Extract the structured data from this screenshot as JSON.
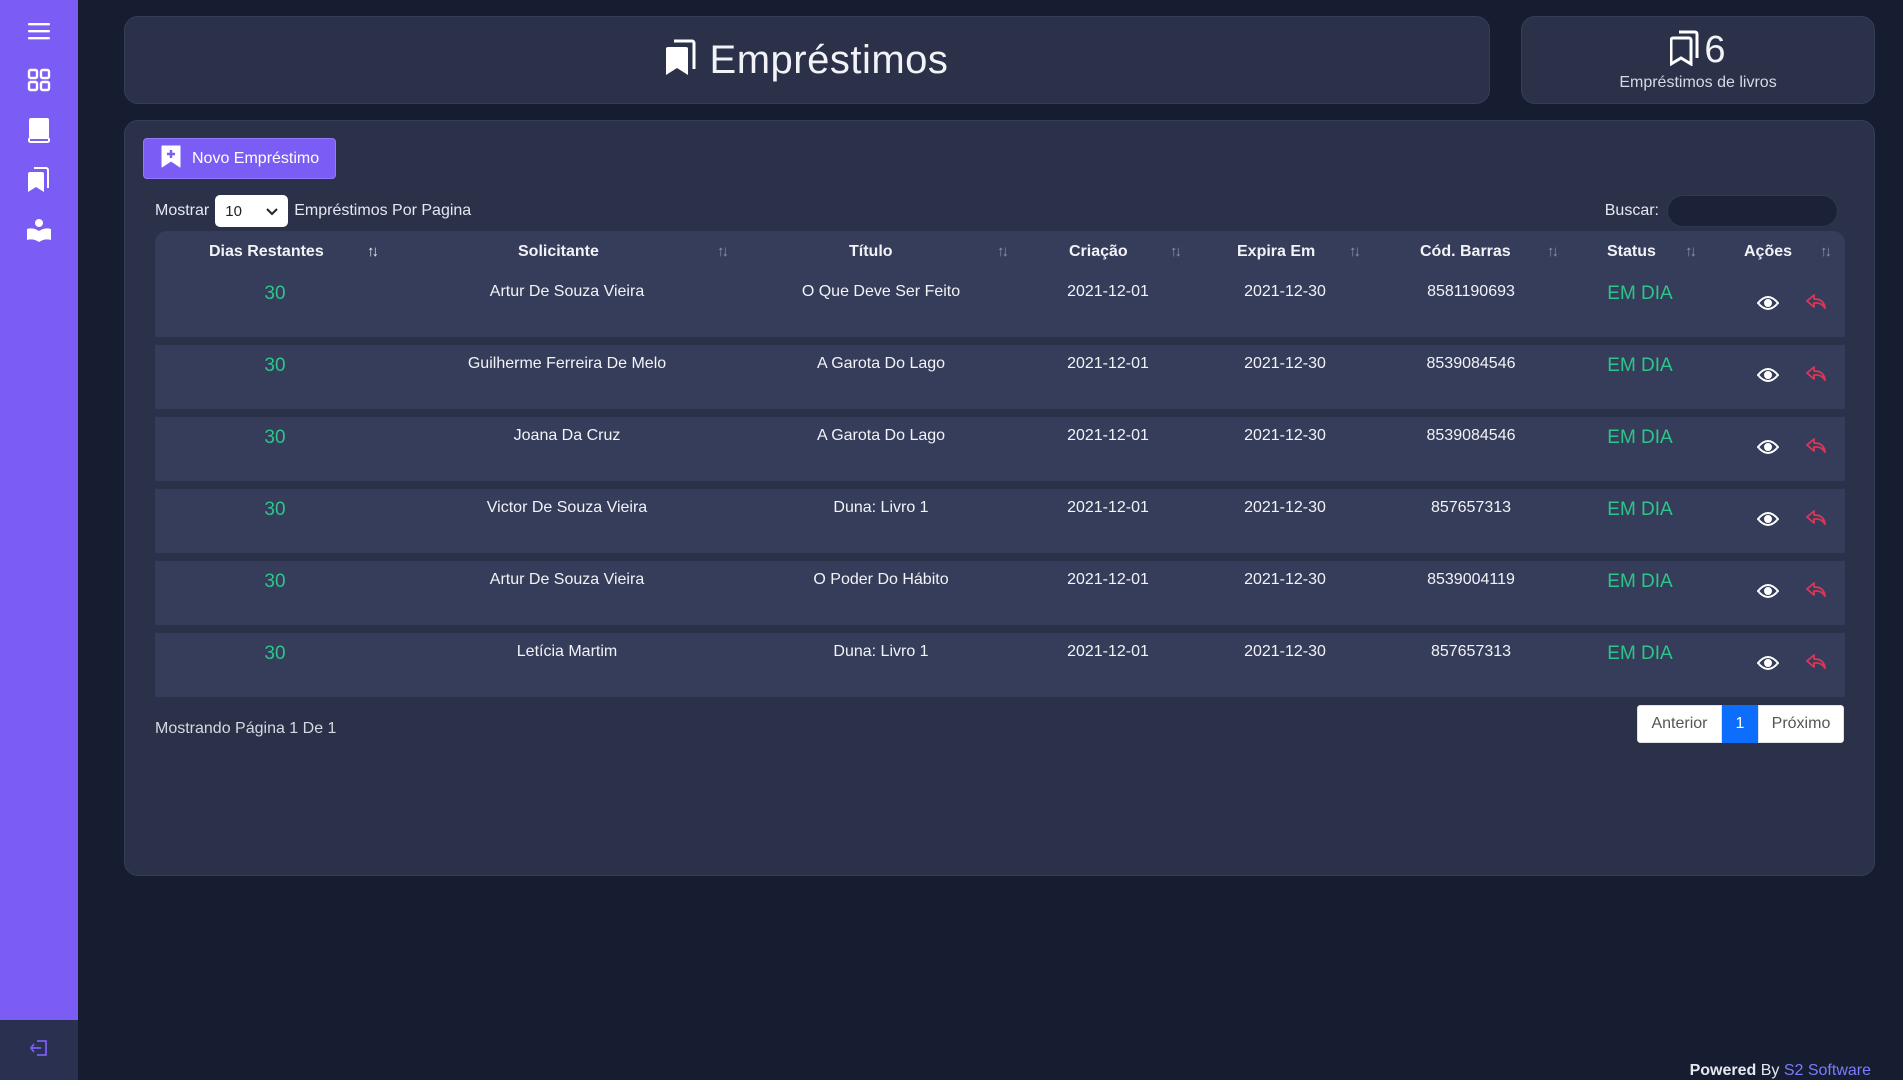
{
  "sidebar": {
    "items": [
      {
        "icon": "menu-icon"
      },
      {
        "icon": "dashboard-icon"
      },
      {
        "icon": "book-icon"
      },
      {
        "icon": "bookmarks-icon"
      },
      {
        "icon": "reader-icon"
      }
    ],
    "bottom_icon": "logout-icon"
  },
  "header": {
    "title": "Empréstimos"
  },
  "stat": {
    "value": "6",
    "label": "Empréstimos de livros"
  },
  "toolbar": {
    "new_label": "Novo Empréstimo",
    "show_label": "Mostrar",
    "page_size": "10",
    "per_page_label": "Empréstimos Por Pagina",
    "search_label": "Buscar:",
    "search_value": ""
  },
  "table": {
    "columns": [
      "Dias Restantes",
      "Solicitante",
      "Título",
      "Criação",
      "Expira Em",
      "Cód. Barras",
      "Status",
      "Ações"
    ],
    "rows": [
      {
        "days": "30",
        "requester": "Artur De Souza Vieira",
        "title": "O Que Deve Ser Feito",
        "created": "2021-12-01",
        "expires": "2021-12-30",
        "barcode": "8581190693",
        "status": "EM DIA"
      },
      {
        "days": "30",
        "requester": "Guilherme Ferreira De Melo",
        "title": "A Garota Do Lago",
        "created": "2021-12-01",
        "expires": "2021-12-30",
        "barcode": "8539084546",
        "status": "EM DIA"
      },
      {
        "days": "30",
        "requester": "Joana Da Cruz",
        "title": "A Garota Do Lago",
        "created": "2021-12-01",
        "expires": "2021-12-30",
        "barcode": "8539084546",
        "status": "EM DIA"
      },
      {
        "days": "30",
        "requester": "Victor De Souza Vieira",
        "title": "Duna: Livro 1",
        "created": "2021-12-01",
        "expires": "2021-12-30",
        "barcode": "857657313",
        "status": "EM DIA"
      },
      {
        "days": "30",
        "requester": "Artur De Souza Vieira",
        "title": "O Poder Do Hábito",
        "created": "2021-12-01",
        "expires": "2021-12-30",
        "barcode": "8539004119",
        "status": "EM DIA"
      },
      {
        "days": "30",
        "requester": "Letícia Martim",
        "title": "Duna: Livro 1",
        "created": "2021-12-01",
        "expires": "2021-12-30",
        "barcode": "857657313",
        "status": "EM DIA"
      }
    ]
  },
  "footer": {
    "info": "Mostrando Página 1 De 1",
    "prev": "Anterior",
    "current": "1",
    "next": "Próximo"
  },
  "powered": {
    "prefix": "Powered",
    "by": "By",
    "brand": "S2 Software"
  },
  "colors": {
    "accent": "#7b5cf5",
    "status_ok": "#2ec58a",
    "danger": "#e0355a",
    "page_active": "#0d6efd"
  }
}
